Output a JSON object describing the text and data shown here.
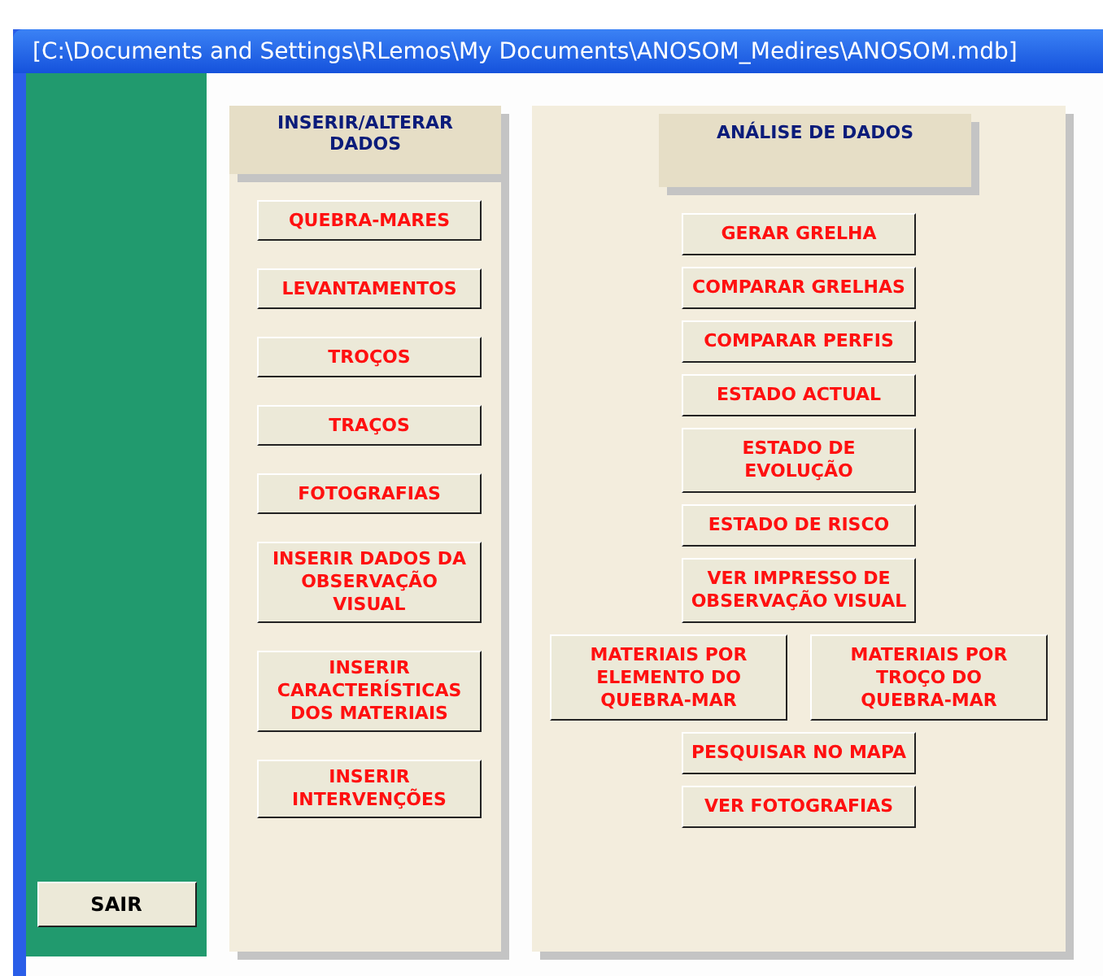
{
  "window": {
    "title": "[C:\\Documents and Settings\\RLemos\\My Documents\\ANOSOM_Medires\\ANOSOM.mdb]"
  },
  "sidebar": {
    "exit_button": "SAIR"
  },
  "left_panel": {
    "title": "INSERIR/ALTERAR\nDADOS",
    "buttons": [
      "QUEBRA-MARES",
      "LEVANTAMENTOS",
      "TROÇOS",
      "TRAÇOS",
      "FOTOGRAFIAS",
      "INSERIR DADOS DA\nOBSERVAÇÃO VISUAL",
      "INSERIR\nCARACTERÍSTICAS\nDOS MATERIAIS",
      "INSERIR\nINTERVENÇÕES"
    ]
  },
  "right_panel": {
    "title": "ANÁLISE DE DADOS",
    "rows": [
      [
        "GERAR GRELHA"
      ],
      [
        "COMPARAR GRELHAS"
      ],
      [
        "COMPARAR PERFIS"
      ],
      [
        "ESTADO ACTUAL"
      ],
      [
        "ESTADO DE EVOLUÇÃO"
      ],
      [
        "ESTADO DE RISCO"
      ],
      [
        "VER IMPRESSO DE\nOBSERVAÇÃO VISUAL"
      ],
      [
        "MATERIAIS POR\nELEMENTO DO\nQUEBRA-MAR",
        "MATERIAIS POR\nTROÇO DO\nQUEBRA-MAR"
      ],
      [
        "PESQUISAR NO MAPA"
      ],
      [
        "VER FOTOGRAFIAS"
      ]
    ]
  }
}
